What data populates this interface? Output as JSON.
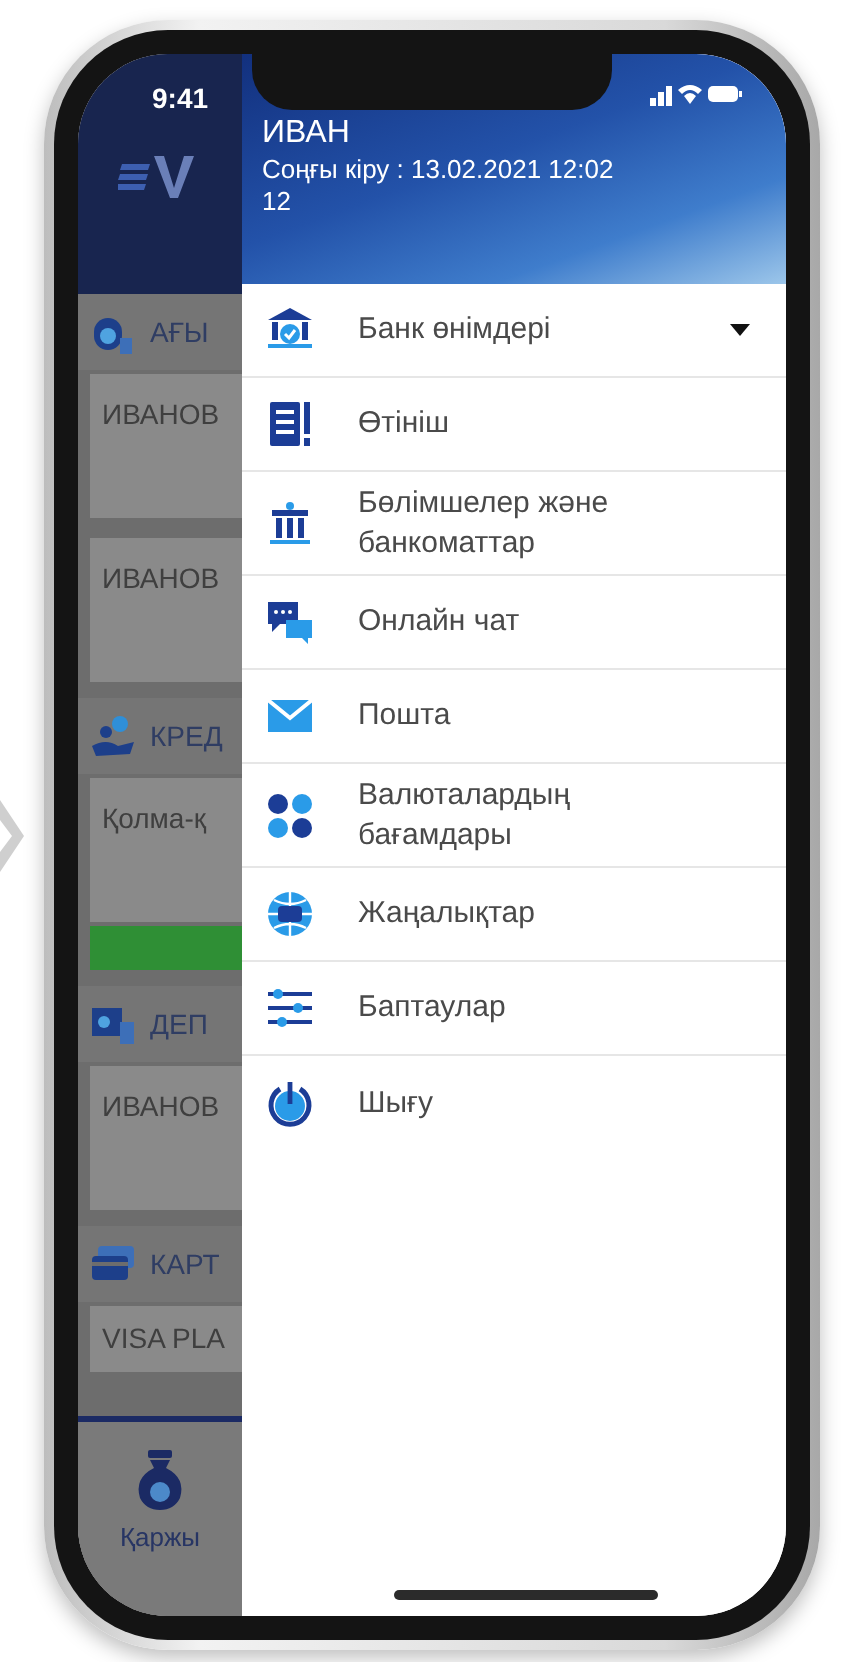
{
  "status_bar": {
    "time": "9:41"
  },
  "background_app": {
    "sections": [
      {
        "title": "АҒЫ",
        "cards": [
          {
            "text": "ИВАНОВ",
            "pay_bar": false
          },
          {
            "text": "ИВАНОВ",
            "pay_bar": false
          }
        ]
      },
      {
        "title": "КРЕД",
        "cards": [
          {
            "text": "Қолма-қ",
            "pay_bar": true
          }
        ]
      },
      {
        "title": "ДЕП",
        "cards": [
          {
            "text": "ИВАНОВ",
            "pay_bar": false
          }
        ]
      },
      {
        "title": "КАРТ",
        "cards": [
          {
            "text": "VISA PLA",
            "pay_bar": false
          }
        ]
      }
    ],
    "tab": {
      "label": "Қаржы"
    }
  },
  "drawer": {
    "user": {
      "name": "ИВАН",
      "last_login": "Соңғы кіру : 13.02.2021 12:02 12"
    },
    "items": [
      {
        "label": "Банк өнімдері",
        "expandable": true
      },
      {
        "label": "Өтініш",
        "expandable": false
      },
      {
        "label": "Бөлімшелер және банкоматтар",
        "expandable": false
      },
      {
        "label": "Онлайн чат",
        "expandable": false
      },
      {
        "label": "Пошта",
        "expandable": false
      },
      {
        "label": "Валюталардың бағамдары",
        "expandable": false
      },
      {
        "label": "Жаңалықтар",
        "expandable": false
      },
      {
        "label": "Баптаулар",
        "expandable": false
      },
      {
        "label": "Шығу",
        "expandable": false
      }
    ]
  }
}
